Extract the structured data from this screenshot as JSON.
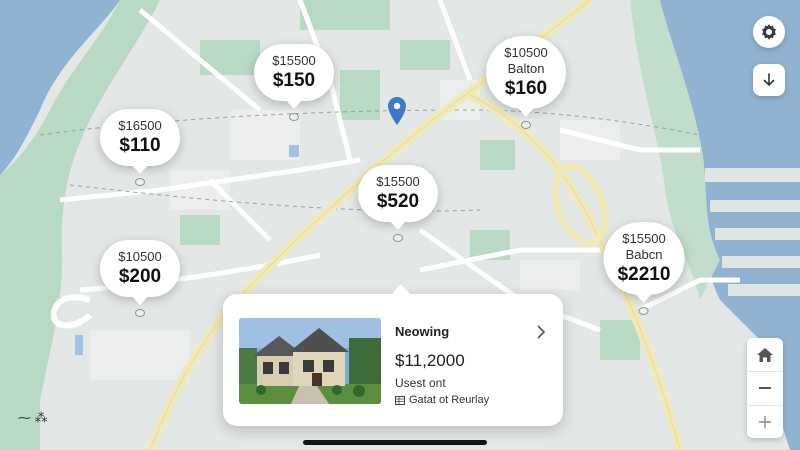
{
  "map": {
    "pins": [
      {
        "id": "pin-1",
        "sub": "$15500",
        "area": "",
        "price": "$150"
      },
      {
        "id": "pin-2",
        "sub": "$10500",
        "area": "Balton",
        "price": "$160"
      },
      {
        "id": "pin-3",
        "sub": "$16500",
        "area": "",
        "price": "$110"
      },
      {
        "id": "pin-4",
        "sub": "$15500",
        "area": "",
        "price": "$520"
      },
      {
        "id": "pin-5",
        "sub": "$10500",
        "area": "",
        "price": "$200"
      },
      {
        "id": "pin-6",
        "sub": "$15500",
        "area": "Babcn",
        "price": "$2210"
      }
    ],
    "location_marker_icon": "map-pin-icon",
    "credit": "⁓ ⁂"
  },
  "controls": {
    "settings_icon": "gear-icon",
    "download_icon": "download-arrow-icon",
    "zoom": [
      {
        "icon": "home-icon"
      },
      {
        "icon": "minus-icon"
      },
      {
        "icon": "plus-icon"
      }
    ]
  },
  "listing_card": {
    "title": "Neowing",
    "price": "$11,2000",
    "subtitle": "Usest ont",
    "detail": "Gatat ot Reurlay",
    "chevron_icon": "chevron-right-icon",
    "detail_icon": "table-icon",
    "photo_icon": "house-photo"
  },
  "colors": {
    "water": "#8fb3d1",
    "land": "#e3e7e6",
    "park": "#b8d9c4",
    "main_road": "#f1e9b8",
    "road": "#ffffff"
  }
}
